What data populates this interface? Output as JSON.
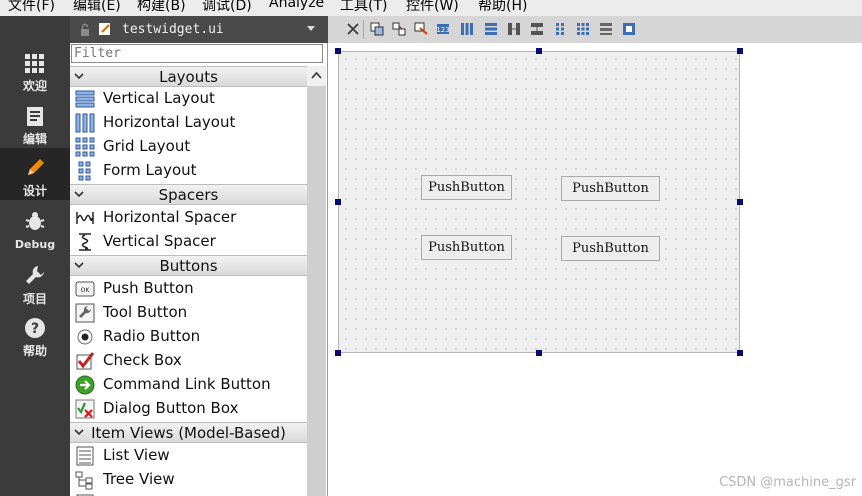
{
  "menubar": {
    "items": [
      "文件(F)",
      "编辑(E)",
      "构建(B)",
      "调试(D)",
      "Analyze",
      "工具(T)",
      "控件(W)",
      "帮助(H)"
    ]
  },
  "modes": [
    {
      "label": "欢迎",
      "icon": "grid-icon"
    },
    {
      "label": "编辑",
      "icon": "document-icon"
    },
    {
      "label": "设计",
      "icon": "pencil-icon",
      "active": true
    },
    {
      "label": "Debug",
      "icon": "bug-icon"
    },
    {
      "label": "项目",
      "icon": "wrench-icon"
    },
    {
      "label": "帮助",
      "icon": "help-icon"
    }
  ],
  "editor": {
    "file_name": "testwidget.ui"
  },
  "widget_box": {
    "filter_placeholder": "Filter",
    "categories": {
      "layouts": "Layouts",
      "spacers": "Spacers",
      "buttons": "Buttons",
      "item_views": "Item Views (Model-Based)"
    },
    "items": {
      "vertical_layout": "Vertical Layout",
      "horizontal_layout": "Horizontal Layout",
      "grid_layout": "Grid Layout",
      "form_layout": "Form Layout",
      "horizontal_spacer": "Horizontal Spacer",
      "vertical_spacer": "Vertical Spacer",
      "push_button": "Push Button",
      "tool_button": "Tool Button",
      "radio_button": "Radio Button",
      "check_box": "Check Box",
      "command_link_button": "Command Link Button",
      "dialog_button_box": "Dialog Button Box",
      "list_view": "List View",
      "tree_view": "Tree View"
    }
  },
  "form": {
    "buttons": [
      "PushButton",
      "PushButton",
      "PushButton",
      "PushButton"
    ]
  },
  "watermark": "CSDN @machine_gsr",
  "colors": {
    "mode_bar": "#3b3b3b",
    "mode_active": "#262626",
    "handle": "#0a0a6e"
  }
}
